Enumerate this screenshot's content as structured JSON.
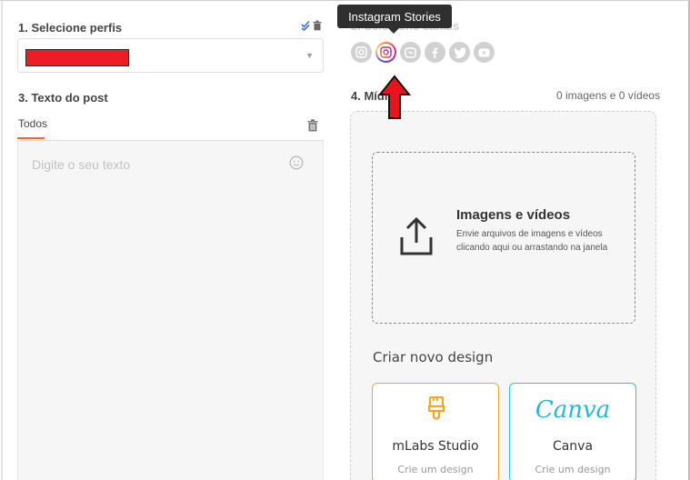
{
  "profiles": {
    "title": "1. Selecione perfis",
    "select_caret": "▼"
  },
  "post_text": {
    "title": "3. Texto do post",
    "tab": "Todos",
    "placeholder": "Digite o seu texto"
  },
  "channels": {
    "title": "2. Selecione canais",
    "tooltip": "Instagram Stories",
    "items": [
      {
        "name": "instagram",
        "icon": "instagram-icon",
        "active": false
      },
      {
        "name": "instagram-stories",
        "icon": "instagram-stories-icon",
        "active": true
      },
      {
        "name": "igtv",
        "icon": "igtv-icon",
        "active": false
      },
      {
        "name": "facebook",
        "icon": "facebook-icon",
        "active": false
      },
      {
        "name": "twitter",
        "icon": "twitter-icon",
        "active": false
      },
      {
        "name": "youtube",
        "icon": "youtube-icon",
        "active": false
      }
    ]
  },
  "media": {
    "title": "4. Mídia",
    "count": "0 imagens e 0 vídeos",
    "dropzone_title": "Imagens e vídeos",
    "dropzone_desc": "Envie arquivos de imagens e vídeos clicando aqui ou arrastando na janela"
  },
  "design": {
    "title": "Criar novo design",
    "cards": [
      {
        "name": "mLabs Studio",
        "sub": "Crie um design"
      },
      {
        "logo": "Canva",
        "name": "Canva",
        "sub": "Crie um design"
      }
    ]
  },
  "colors": {
    "accent": "#f26b1d",
    "redaction": "#ee1c24",
    "arrow": "#e8141a",
    "mlabs_border": "#f5a623",
    "canva": "#25c4e3"
  }
}
